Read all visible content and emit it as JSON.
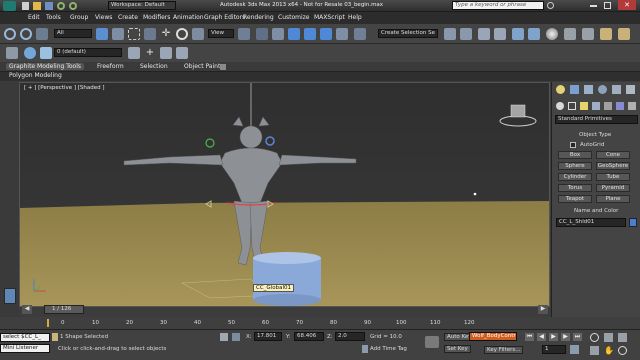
{
  "title_bar": {
    "workspace_label": "Workspace: Default",
    "title": "Autodesk 3ds Max  2013 x64    - Not for Resale    03_begin.max",
    "search_placeholder": "Type a keyword or phrase"
  },
  "menu": [
    "Edit",
    "Tools",
    "Group",
    "Views",
    "Create",
    "Modifiers",
    "Animation",
    "Graph Editors",
    "Rendering",
    "Customize",
    "MAXScript",
    "Help"
  ],
  "toolbar": {
    "selection_filter": "All",
    "reference_coord": "View",
    "named_selection": "Create Selection Se"
  },
  "layer_bar": {
    "layer_name": "0 (default)"
  },
  "ribbon": {
    "tabs": [
      "Graphite Modeling Tools",
      "Freeform",
      "Selection",
      "Object Paint"
    ],
    "subtab": "Polygon Modeling"
  },
  "viewport": {
    "label": "[ + ] [Perspective ] [Shaded ]",
    "object_tooltip": "CC_Global01"
  },
  "command_panel": {
    "category": "Standard Primitives",
    "object_type_header": "Object Type",
    "autogrid_label": "AutoGrid",
    "buttons": [
      "Box",
      "Cone",
      "Sphere",
      "GeoSphere",
      "Cylinder",
      "Tube",
      "Torus",
      "Pyramid",
      "Teapot",
      "Plane"
    ],
    "name_color_header": "Name and Color",
    "object_name": "CC_L_Shld01",
    "object_color": "#4a7fd0"
  },
  "timeline": {
    "frame_counter": "1 / 126",
    "ticks": [
      "0",
      "10",
      "20",
      "30",
      "40",
      "50",
      "60",
      "70",
      "80",
      "90",
      "100",
      "110",
      "120"
    ]
  },
  "status": {
    "maxscript_line1": "select $CC_L_",
    "maxscript_line2": "Mini Listener",
    "selection_info": "1 Shape Selected",
    "prompt": "Click or click-and-drag to select objects",
    "x_label": "X:",
    "x_value": "17.801",
    "y_label": "Y:",
    "y_value": "68.406",
    "z_label": "Z:",
    "z_value": "2.0",
    "grid": "Grid = 10.0",
    "add_time_tag": "Add Time Tag",
    "auto_key": "Auto Key",
    "set_key": "Set Key",
    "key_selection": "Wolf_BodyControl",
    "key_filters": "Key Filters...",
    "current_frame": "1"
  },
  "colors": {
    "auto_key_accent": "#c5432a",
    "key_selection_bg": "#d15e1e",
    "ground": "#9c8a4d",
    "viewport_bg": "#333333",
    "cylinder": "#8aa8d8"
  }
}
